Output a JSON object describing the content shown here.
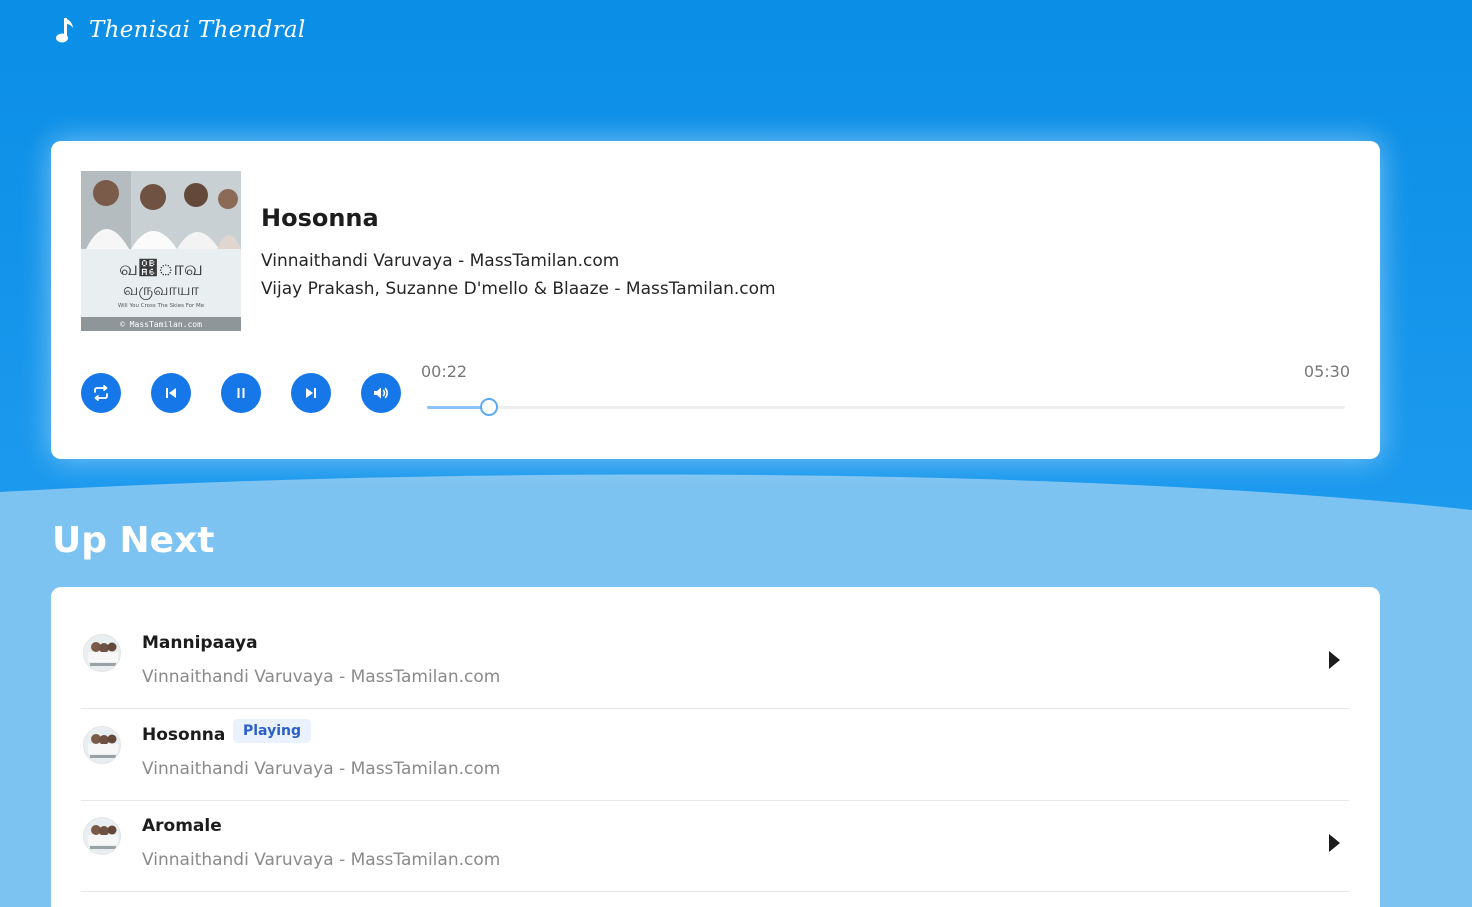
{
  "header": {
    "brand": "Thenisai Thendral"
  },
  "player": {
    "title": "Hosonna",
    "album": "Vinnaithandi Varuvaya - MassTamilan.com",
    "artists": "Vijay Prakash, Suzanne D'mello & Blaaze - MassTamilan.com",
    "current_time": "00:22",
    "duration": "05:30",
    "progress_fraction": 0.067,
    "cover_caption": "Will You Cross The Skies For Me",
    "cover_watermark": "© MassTamilan.com",
    "controls": [
      "repeat-icon",
      "previous-icon",
      "pause-icon",
      "next-icon",
      "volume-icon"
    ]
  },
  "up_next": {
    "heading": "Up Next",
    "items": [
      {
        "title": "Mannipaaya",
        "subtitle": "Vinnaithandi Varuvaya - MassTamilan.com",
        "playing": false
      },
      {
        "title": "Hosonna",
        "subtitle": "Vinnaithandi Varuvaya - MassTamilan.com",
        "playing": true,
        "badge": "Playing"
      },
      {
        "title": "Aromale",
        "subtitle": "Vinnaithandi Varuvaya - MassTamilan.com",
        "playing": false
      }
    ]
  },
  "colors": {
    "hero": "#0a8ee6",
    "accent": "#1677e8",
    "lower_background": "#7cc3f1",
    "progress_fill": "#8ac3f8",
    "badge_bg": "#eaf2ff",
    "badge_text": "#2b5fc7"
  }
}
